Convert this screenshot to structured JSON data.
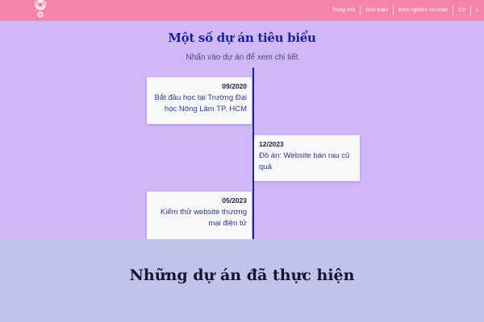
{
  "nav": {
    "links": [
      "Trang chủ",
      "Giới thiệu",
      "Kinh nghiệm cá nhân",
      "CV",
      "L"
    ]
  },
  "colors": {
    "navbar": "#f585a8",
    "page_background": "#d0b7f5",
    "caption_band": "#c1c3ec",
    "title": "#1d1e99",
    "timeline_line": "#24257d"
  },
  "section": {
    "title": "Một số dự án tiêu biểu",
    "subtitle": "Nhấn vào dự án để xem chi tiết"
  },
  "timeline": [
    {
      "date": "09/2020",
      "text": "Bắt đầu học tại Trường Đại học Nông Lâm TP. HCM",
      "side": "left"
    },
    {
      "date": "12/2023",
      "text": "Đồ án: Website bán rau củ quả",
      "side": "right"
    },
    {
      "date": "05/2023",
      "text": "Kiểm thử website thương mại điện tử",
      "side": "left"
    }
  ],
  "caption": "Những dự án đã thực hiện",
  "icons": {
    "logo": "flower-logo-icon"
  }
}
